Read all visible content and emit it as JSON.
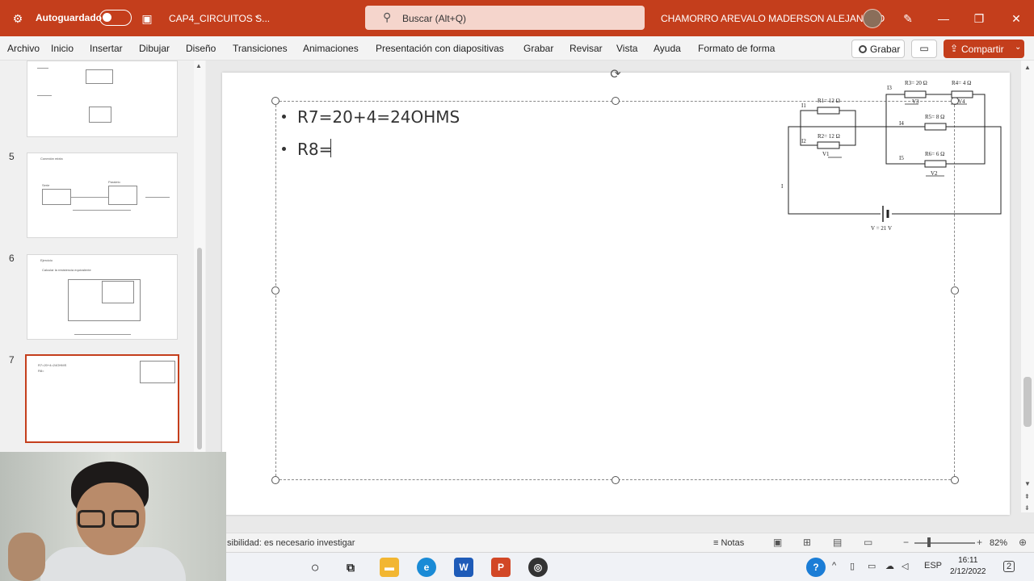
{
  "titlebar": {
    "autosave_label": "Autoguardado",
    "filename": "CAP4_CIRCUITOS S...",
    "search_placeholder": "Buscar (Alt+Q)",
    "username": "CHAMORRO AREVALO MADERSON ALEJANDRO"
  },
  "menu": {
    "items": [
      "Archivo",
      "Inicio",
      "Insertar",
      "Dibujar",
      "Diseño",
      "Transiciones",
      "Animaciones",
      "Presentación con diapositivas",
      "Grabar",
      "Revisar",
      "Vista",
      "Ayuda",
      "Formato de forma"
    ],
    "record_button": "Grabar",
    "share_button": "Compartir"
  },
  "thumbnails": [
    {
      "number": "",
      "title": ""
    },
    {
      "number": "5",
      "title": "Conexión mixta",
      "labels": [
        "Serie",
        "Paralelo"
      ]
    },
    {
      "number": "6",
      "title": "Ejercicio",
      "subtitle": "Calcular la resistencia equivalente"
    },
    {
      "number": "7",
      "lines": [
        "R7=20+4=24OHMS",
        "R8="
      ]
    }
  ],
  "slide": {
    "bullets": [
      "R7=20+4=24OHMS",
      "R8="
    ],
    "circuit": {
      "labels": {
        "r3": "R3= 20 Ω",
        "r4": "R4= 4 Ω",
        "r1": "R1= 12 Ω",
        "r2": "R2= 12 Ω",
        "r5": "R5= 8 Ω",
        "r6": "R6= 6 Ω",
        "i1": "I1",
        "i2": "I2",
        "i3": "I3",
        "i4": "I4",
        "i5": "I5",
        "i": "I",
        "v1": "V1",
        "v2": "V2",
        "v3": "V3",
        "v4": "V4",
        "source": "V = 21 V"
      }
    }
  },
  "statusbar": {
    "accessibility": "sibilidad: es necesario investigar",
    "notes": "Notas",
    "zoom": "82%"
  },
  "taskbar": {
    "apps": [
      "search",
      "task-view",
      "file-explorer",
      "edge",
      "word",
      "powerpoint",
      "recorder"
    ],
    "language": "ESP",
    "time": "16:11",
    "date": "2/12/2022",
    "notification_count": "2"
  }
}
